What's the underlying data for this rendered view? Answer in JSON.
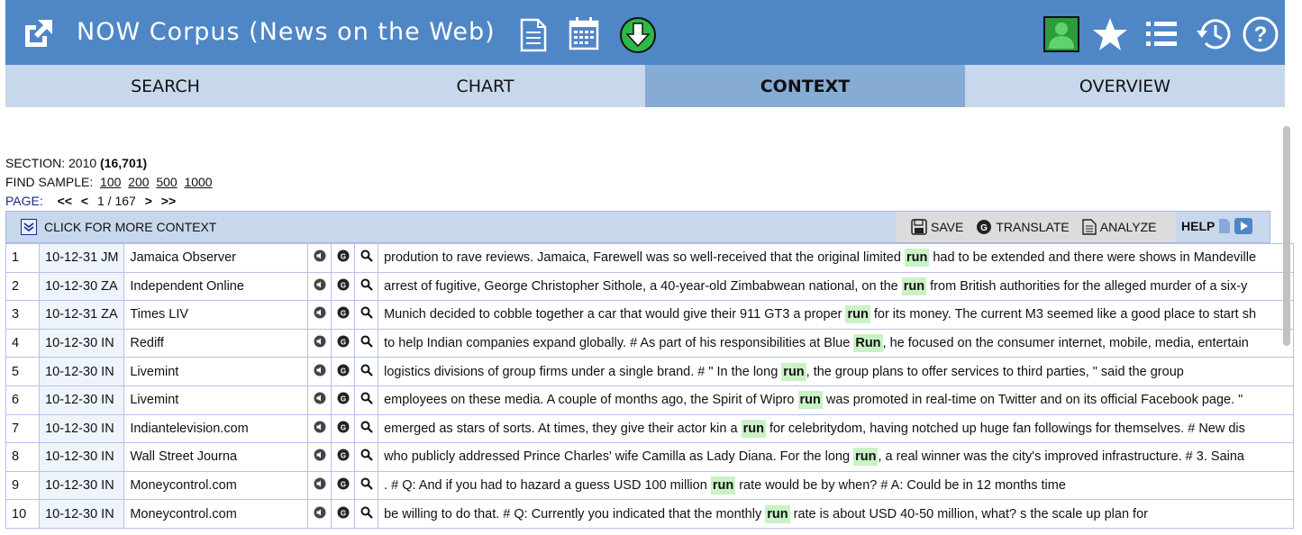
{
  "header": {
    "title": "NOW Corpus (News on the Web)",
    "icons": [
      "external-link-icon",
      "document-icon",
      "calendar-icon",
      "download-icon",
      "user-icon",
      "star-icon",
      "list-icon",
      "history-icon",
      "help-icon"
    ],
    "brand_color": "#4f86c6"
  },
  "tabs": [
    {
      "label": "SEARCH"
    },
    {
      "label": "CHART"
    },
    {
      "label": "CONTEXT"
    },
    {
      "label": "OVERVIEW"
    }
  ],
  "info": {
    "section_label": "SECTION: 2010",
    "section_count": "(16,701)",
    "find_sample_label": "FIND SAMPLE:",
    "samples": [
      "100",
      "200",
      "500",
      "1000"
    ],
    "page_label": "PAGE:",
    "page_first": "<<",
    "page_prev": "<",
    "page_value": "1 / 167",
    "page_next": ">",
    "page_last": ">>"
  },
  "toolbar": {
    "more_context": "CLICK FOR MORE CONTEXT",
    "save": "SAVE",
    "translate": "TRANSLATE",
    "analyze": "ANALYZE",
    "help": "HELP"
  },
  "rows": [
    {
      "num": "1",
      "date": "10-12-31 JM",
      "source": "Jamaica Observer",
      "before": "prodution to rave reviews. Jamaica, Farewell was so well-received that the original limited ",
      "kw": "run",
      "after": " had to be extended and there were shows in Mandeville"
    },
    {
      "num": "2",
      "date": "10-12-30 ZA",
      "source": "Independent Online",
      "before": "arrest of fugitive, George Christopher Sithole, a 40-year-old Zimbabwean national, on the ",
      "kw": "run",
      "after": " from British authorities for the alleged murder of a six-y"
    },
    {
      "num": "3",
      "date": "10-12-31 ZA",
      "source": "Times LIV",
      "before": "Munich decided to cobble together a car that would give their 911 GT3 a proper ",
      "kw": "run",
      "after": " for its money. The current M3 seemed like a good place to start sh"
    },
    {
      "num": "4",
      "date": "10-12-30 IN",
      "source": "Rediff",
      "before": "to help Indian companies expand globally. # As part of his responsibilities at Blue ",
      "kw": "Run",
      "after": ", he focused on the consumer internet, mobile, media, entertain"
    },
    {
      "num": "5",
      "date": "10-12-30 IN",
      "source": "Livemint",
      "before": "logistics divisions of group firms under a single brand. # \" In the long ",
      "kw": "run",
      "after": ", the group plans to offer services to third parties, \" said the group"
    },
    {
      "num": "6",
      "date": "10-12-30 IN",
      "source": "Livemint",
      "before": "employees on these media. A couple of months ago, the Spirit of Wipro ",
      "kw": "run",
      "after": " was promoted in real-time on Twitter and on its official Facebook page. \""
    },
    {
      "num": "7",
      "date": "10-12-30 IN",
      "source": "Indiantelevision.com",
      "before": "emerged as stars of sorts. At times, they give their actor kin a ",
      "kw": "run",
      "after": " for celebritydom, having notched up huge fan followings for themselves. # New dis"
    },
    {
      "num": "8",
      "date": "10-12-30 IN",
      "source": "Wall Street Journa",
      "before": "who publicly addressed Prince Charles' wife Camilla as Lady Diana. For the long ",
      "kw": "run",
      "after": ", a real winner was the city's improved infrastructure. # 3. Saina"
    },
    {
      "num": "9",
      "date": "10-12-30 IN",
      "source": "Moneycontrol.com",
      "before": ". # Q: And if you had to hazard a guess USD 100 million ",
      "kw": "run",
      "after": " rate would be by when? # A: Could be in 12 months time"
    },
    {
      "num": "10",
      "date": "10-12-30 IN",
      "source": "Moneycontrol.com",
      "before": "be willing to do that. # Q: Currently you indicated that the monthly ",
      "kw": "run",
      "after": " rate is about USD 40-50 million, what? s the scale up plan for"
    }
  ]
}
